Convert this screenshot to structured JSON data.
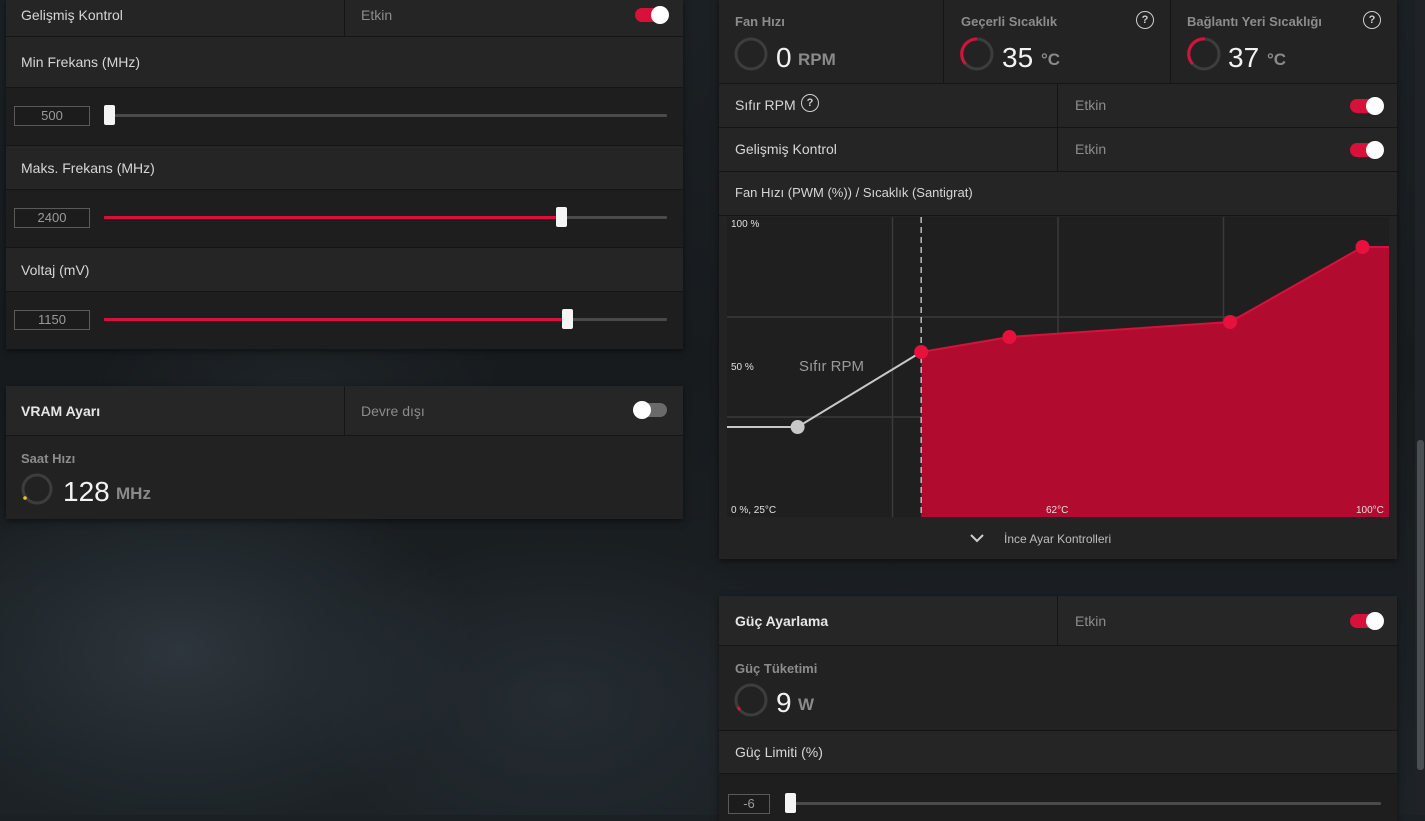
{
  "left_top": {
    "advanced_control_label": "Gelişmiş Kontrol",
    "advanced_control_state": "Etkin",
    "min_freq_label": "Min Frekans (MHz)",
    "min_freq_value": "500",
    "min_freq_fraction": 0.0,
    "max_freq_label": "Maks. Frekans (MHz)",
    "max_freq_value": "2400",
    "max_freq_fraction": 0.818,
    "voltage_label": "Voltaj (mV)",
    "voltage_value": "1150",
    "voltage_fraction": 0.83
  },
  "vram": {
    "title": "VRAM Ayarı",
    "state": "Devre dışı",
    "clock_label": "Saat Hızı",
    "clock_value": "128",
    "clock_unit": "MHz"
  },
  "fan": {
    "stats": [
      {
        "label": "Fan Hızı",
        "value": "0",
        "unit": "RPM",
        "help": false
      },
      {
        "label": "Geçerli Sıcaklık",
        "value": "35",
        "unit": "°C",
        "help": true
      },
      {
        "label": "Bağlantı Yeri Sıcaklığı",
        "value": "37",
        "unit": "°C",
        "help": true
      }
    ],
    "zero_rpm_label": "Sıfır RPM",
    "zero_rpm_state": "Etkin",
    "advanced_control_label": "Gelişmiş Kontrol",
    "advanced_control_state": "Etkin",
    "curve_title": "Fan Hızı (PWM (%)) / Sıcaklık (Santigrat)",
    "fine_tune_label": "İnce Ayar Kontrolleri",
    "help_glyph": "?"
  },
  "chart_data": {
    "type": "area",
    "y_top_label": "100 %",
    "y_mid_label": "50 %",
    "origin_label": "0 %, 25°C",
    "x_mid_label": "62°C",
    "x_end_label": "100°C",
    "zero_rpm_annotation": "Sıfır RPM",
    "xlim": [
      25,
      100
    ],
    "ylim": [
      0,
      100
    ],
    "zero_rpm_point": {
      "x": 33,
      "y": 30
    },
    "points": [
      {
        "x": 47,
        "y": 55
      },
      {
        "x": 57,
        "y": 60
      },
      {
        "x": 82,
        "y": 65
      },
      {
        "x": 97,
        "y": 90
      }
    ],
    "line_color": "#d8113a",
    "zero_rpm_color": "#c8c8c8"
  },
  "power": {
    "title": "Güç Ayarlama",
    "state": "Etkin",
    "consumption_label": "Güç Tüketimi",
    "consumption_value": "9",
    "consumption_unit": "W",
    "limit_label": "Güç Limiti (%)",
    "limit_value": "-6"
  },
  "colors": {
    "accent": "#d8113a",
    "panel": "#232323"
  }
}
